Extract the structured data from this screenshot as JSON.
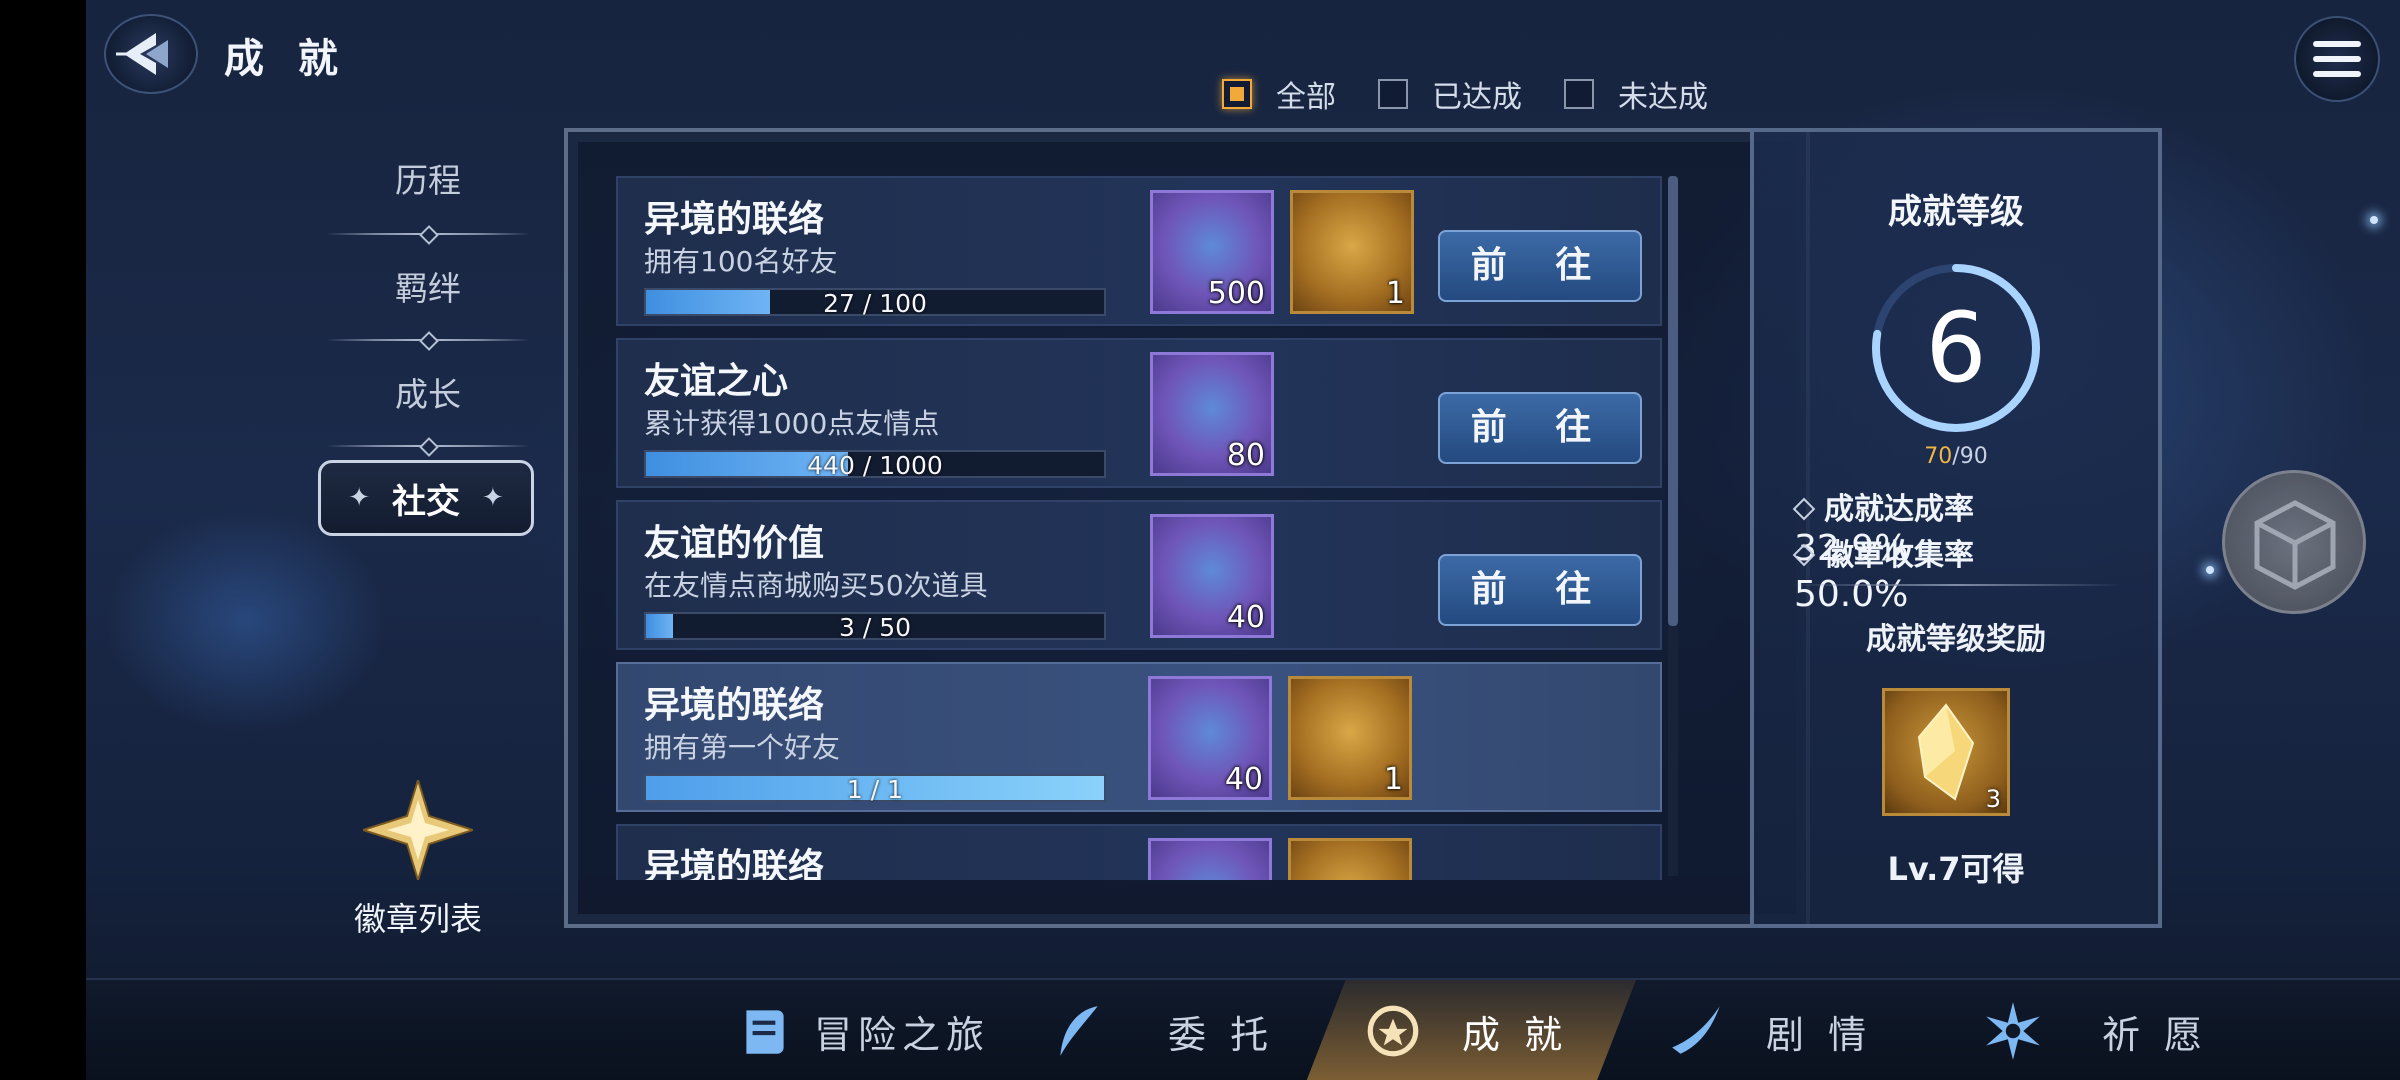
{
  "header": {
    "title": "成 就"
  },
  "filters": [
    {
      "label": "全部",
      "active": true
    },
    {
      "label": "已达成",
      "active": false
    },
    {
      "label": "未达成",
      "active": false
    }
  ],
  "sidebar": {
    "items": [
      {
        "label": "历程"
      },
      {
        "label": "羁绊"
      },
      {
        "label": "成长"
      },
      {
        "label": "社交"
      }
    ],
    "badge_list_label": "徽章列表"
  },
  "achievements": [
    {
      "name": "异境的联络",
      "desc": "拥有100名好友",
      "progress_text": "27 / 100",
      "progress": 0.27,
      "rewards": [
        "500",
        "1"
      ],
      "button": "前 往",
      "done": false
    },
    {
      "name": "友谊之心",
      "desc": "累计获得1000点友情点",
      "progress_text": "440 / 1000",
      "progress": 0.44,
      "rewards": [
        "80"
      ],
      "button": "前 往",
      "done": false
    },
    {
      "name": "友谊的价值",
      "desc": "在友情点商城购买50次道具",
      "progress_text": "3 / 50",
      "progress": 0.06,
      "rewards": [
        "40"
      ],
      "button": "前 往",
      "done": false
    },
    {
      "name": "异境的联络",
      "desc": "拥有第一个好友",
      "progress_text": "1 / 1",
      "progress": 1.0,
      "rewards": [
        "40",
        "1"
      ],
      "done": true
    },
    {
      "name": "异境的联络"
    }
  ],
  "level_panel": {
    "title": "成就等级",
    "level": "6",
    "exp_current": "70",
    "exp_total": "/90",
    "exp_progress": 0.778,
    "completion_label": "成就达成率",
    "completion_value": "32.9%",
    "badge_label": "徽章收集率",
    "badge_value": "50.0%",
    "reward_title": "成就等级奖励",
    "reward_count": "3",
    "reward_note": "Lv.7可得"
  },
  "bottom_nav": [
    {
      "label": "冒险之旅",
      "active": false
    },
    {
      "label": "委 托",
      "active": false
    },
    {
      "label": "成 就",
      "active": true
    },
    {
      "label": "剧 情",
      "active": false
    },
    {
      "label": "祈 愿",
      "active": false
    }
  ],
  "colors": {
    "accent": "#f1a93a",
    "progress": "#5aa6ee",
    "button": "#2f5a94"
  }
}
